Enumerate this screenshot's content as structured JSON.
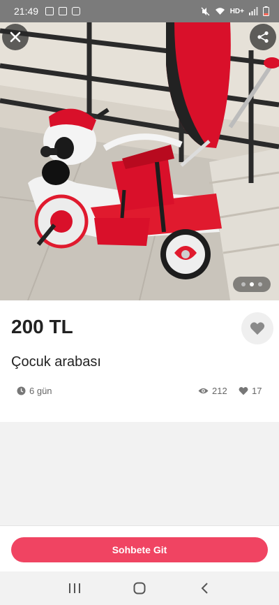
{
  "status_bar": {
    "time": "21:49",
    "network": "HD+",
    "icons": [
      "image-icon",
      "calendar-icon",
      "app-icon",
      "mute-icon",
      "wifi-icon",
      "signal-icon",
      "battery-icon"
    ]
  },
  "photo": {
    "subject": "child-tricycle-image",
    "close_icon": "close-icon",
    "share_icon": "share-icon",
    "pager": {
      "count": 3,
      "active_index": 1
    }
  },
  "listing": {
    "price": "200 TL",
    "title": "Çocuk arabası",
    "age": "6 gün",
    "views": "212",
    "likes": "17",
    "favorite_icon": "heart-icon"
  },
  "actions": {
    "chat_label": "Sohbete Git",
    "chat_color": "#f04462"
  },
  "nav": {
    "icons": [
      "recents-icon",
      "home-icon",
      "back-icon"
    ]
  }
}
